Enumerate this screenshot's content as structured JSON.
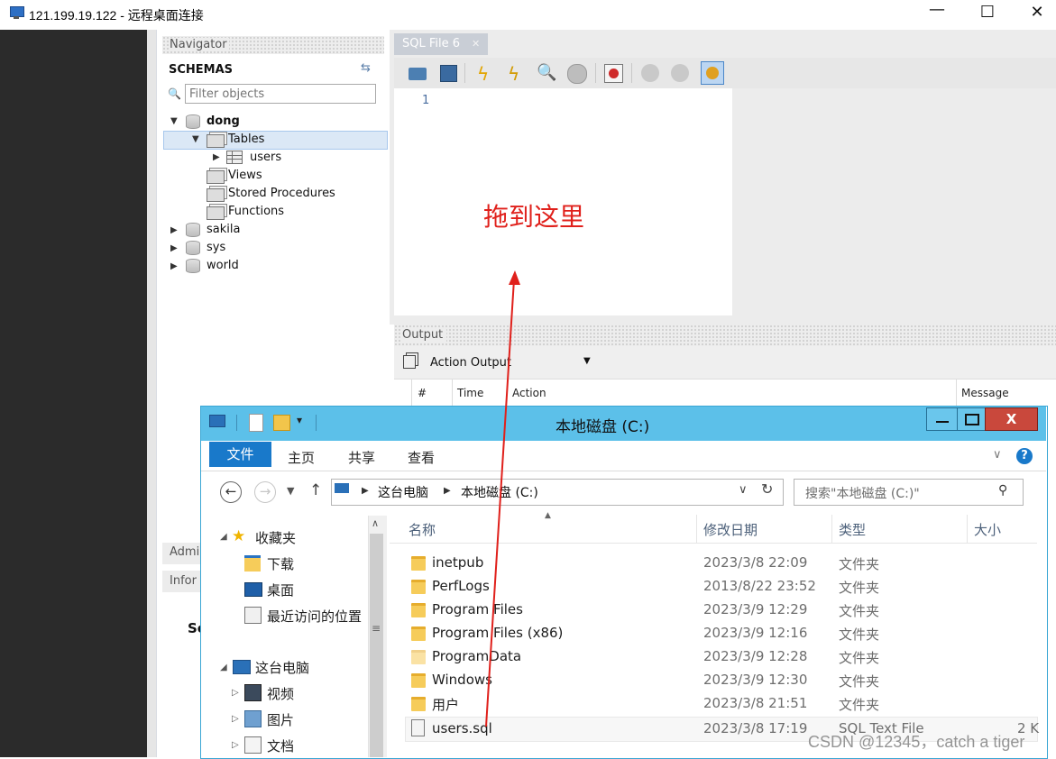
{
  "rdp": {
    "title": "121.199.19.122 - 远程桌面连接",
    "minimize": "—",
    "maximize": "☐",
    "close": "✕"
  },
  "navigator": {
    "header": "Navigator",
    "schemas_label": "SCHEMAS",
    "filter_placeholder": "Filter objects",
    "tree": {
      "dong": "dong",
      "tables": "Tables",
      "users": "users",
      "views": "Views",
      "procs": "Stored Procedures",
      "funcs": "Functions",
      "sakila": "sakila",
      "sys": "sys",
      "world": "world"
    },
    "admin_tab": "Admi",
    "info_tab": "Infor",
    "partial": "Sc"
  },
  "editor": {
    "tab_label": "SQL File 6",
    "tab_close": "✕",
    "line_number": "1",
    "annotation": "拖到这里",
    "annotation_color": "#e0201b"
  },
  "output": {
    "header": "Output",
    "dropdown": "Action Output",
    "columns": {
      "num": "#",
      "time": "Time",
      "action": "Action",
      "message": "Message"
    }
  },
  "explorer": {
    "title": "本地磁盘 (C:)",
    "ribbon": {
      "file": "文件",
      "home": "主页",
      "share": "共享",
      "view": "查看"
    },
    "address": {
      "root": "这台电脑",
      "current": "本地磁盘 (C:)"
    },
    "search_placeholder": "搜索\"本地磁盘 (C:)\"",
    "nav": {
      "favorites": "收藏夹",
      "downloads": "下载",
      "desktop": "桌面",
      "recent": "最近访问的位置",
      "this_pc": "这台电脑",
      "videos": "视频",
      "pictures": "图片",
      "documents": "文档"
    },
    "columns": {
      "name": "名称",
      "date": "修改日期",
      "type": "类型",
      "size": "大小"
    },
    "files": [
      {
        "name": "inetpub",
        "date": "2023/3/8 22:09",
        "type": "文件夹",
        "size": ""
      },
      {
        "name": "PerfLogs",
        "date": "2013/8/22 23:52",
        "type": "文件夹",
        "size": ""
      },
      {
        "name": "Program Files",
        "date": "2023/3/9 12:29",
        "type": "文件夹",
        "size": ""
      },
      {
        "name": "Program Files (x86)",
        "date": "2023/3/9 12:16",
        "type": "文件夹",
        "size": ""
      },
      {
        "name": "ProgramData",
        "date": "2023/3/9 12:28",
        "type": "文件夹",
        "size": ""
      },
      {
        "name": "Windows",
        "date": "2023/3/9 12:30",
        "type": "文件夹",
        "size": ""
      },
      {
        "name": "用户",
        "date": "2023/3/8 21:51",
        "type": "文件夹",
        "size": ""
      },
      {
        "name": "users.sql",
        "date": "2023/3/8 17:19",
        "type": "SQL Text File",
        "size": "2 K"
      }
    ]
  },
  "watermark": "CSDN @12345，catch a tiger"
}
